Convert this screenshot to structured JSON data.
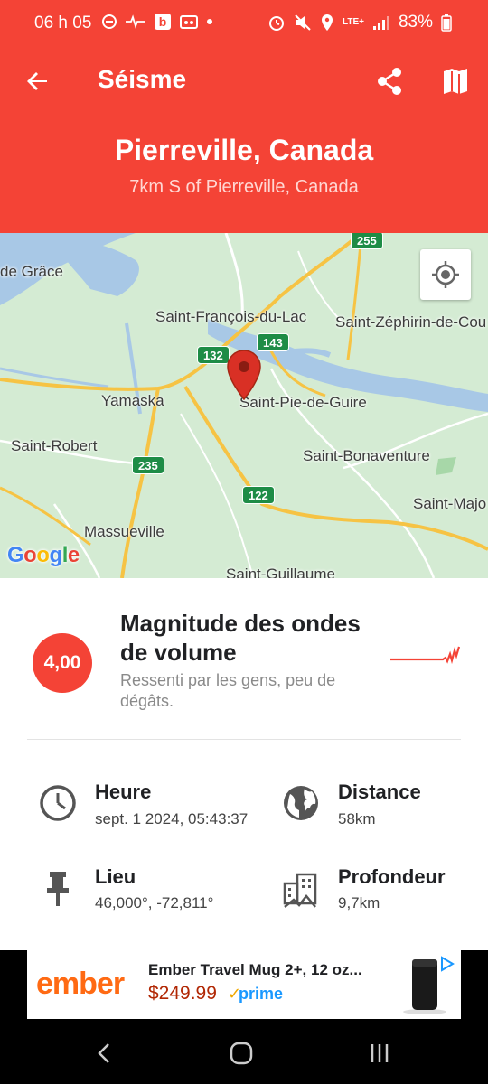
{
  "status_bar": {
    "time": "06 h 05",
    "battery_text": "83%",
    "network_text": "LTE+"
  },
  "app_bar": {
    "title": "Séisme",
    "back_icon": "arrow-back-icon",
    "share_icon": "share-icon",
    "map_icon": "map-icon"
  },
  "header": {
    "place": "Pierreville, Canada",
    "subplace": "7km S of Pierreville, Canada"
  },
  "map": {
    "labels": [
      {
        "text": "de Grâce"
      },
      {
        "text": "Saint-François-du-Lac"
      },
      {
        "text": "Saint-Zéphirin-de-Cou"
      },
      {
        "text": "Yamaska"
      },
      {
        "text": "Saint-Pie-de-Guire"
      },
      {
        "text": "Saint-Robert"
      },
      {
        "text": "Saint-Bonaventure"
      },
      {
        "text": "Saint-Majo"
      },
      {
        "text": "Massueville"
      },
      {
        "text": "Saint-Guillaume"
      }
    ],
    "shields": [
      {
        "text": "255"
      },
      {
        "text": "132"
      },
      {
        "text": "143"
      },
      {
        "text": "235"
      },
      {
        "text": "122"
      }
    ],
    "attribution": "Google",
    "locate_icon": "my-location-icon"
  },
  "magnitude": {
    "value": "4,00",
    "title": "Magnitude des ondes de volume",
    "description": "Ressenti par les gens, peu de dégâts."
  },
  "details": {
    "time": {
      "label": "Heure",
      "value": "sept. 1 2024, 05:43:37",
      "icon": "clock-icon"
    },
    "distance": {
      "label": "Distance",
      "value": "58km",
      "icon": "globe-icon"
    },
    "location": {
      "label": "Lieu",
      "value": "46,000°, -72,811°",
      "icon": "pin-icon"
    },
    "depth": {
      "label": "Profondeur",
      "value": "9,7km",
      "icon": "city-depth-icon"
    }
  },
  "ad": {
    "brand": "ember",
    "title": "Ember Travel Mug 2+, 12 oz...",
    "price": "$249.99",
    "prime": "prime"
  },
  "colors": {
    "primary": "#f44336",
    "map_land": "#d4ebd3",
    "map_water": "#a8c8e6",
    "road_major": "#f6c344"
  }
}
